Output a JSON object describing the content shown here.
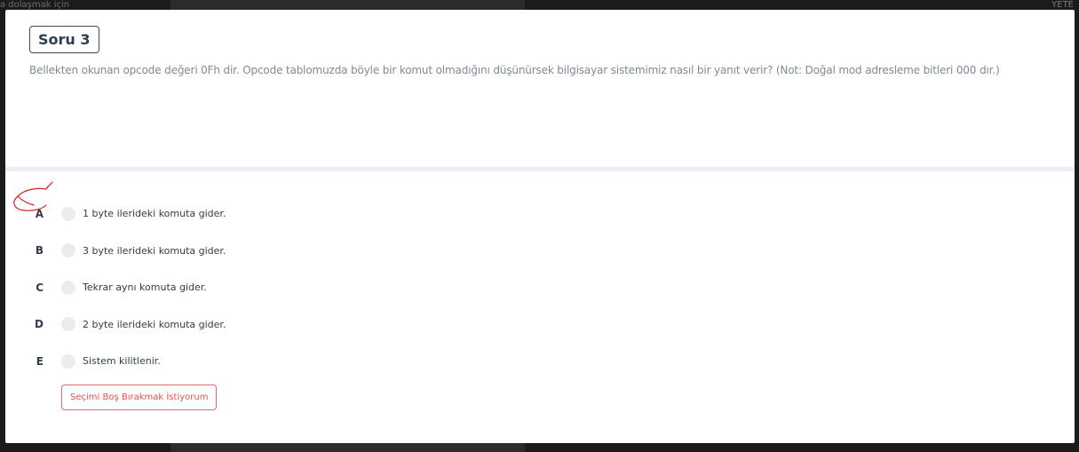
{
  "background": {
    "left_text": "a dolaşmak için",
    "right_text": "YETE"
  },
  "question": {
    "badge": "Soru 3",
    "text": "Bellekten okunan opcode değeri 0Fh dir. Opcode tablomuzda böyle bir komut olmadığını düşünürsek bilgisayar sistemimiz nasıl bir yanıt verir? (Not: Doğal mod adresleme bitleri 000 dır.)"
  },
  "options": [
    {
      "letter": "A",
      "text": "1 byte ilerideki komuta gider."
    },
    {
      "letter": "B",
      "text": "3 byte ilerideki komuta gider."
    },
    {
      "letter": "C",
      "text": "Tekrar aynı komuta gider."
    },
    {
      "letter": "D",
      "text": "2 byte ilerideki komuta gider."
    },
    {
      "letter": "E",
      "text": "Sistem kilitlenir."
    }
  ],
  "skip_button": "Seçimi Boş Bırakmak İstiyorum",
  "colors": {
    "annotation": "#d22020",
    "skip_border": "#e06a6a",
    "divider": "#ececf5"
  }
}
